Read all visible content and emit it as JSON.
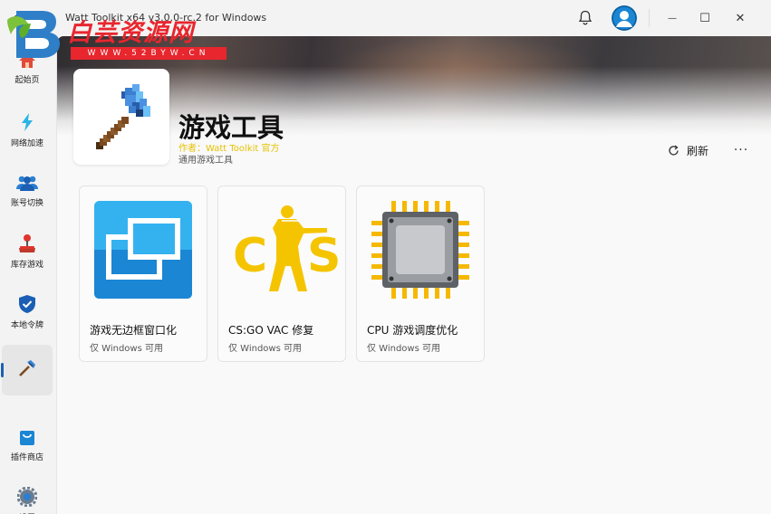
{
  "window": {
    "app_title": "Watt Toolkit x64 v3.0.0-rc.2 for Windows",
    "back_glyph": "←",
    "minimize_glyph": "—",
    "maximize_glyph": "☐",
    "close_glyph": "✕"
  },
  "watermark": {
    "brand_text": "白芸资源网",
    "url_text": "WWW.52BYW.CN",
    "color": "#e8262e"
  },
  "sidebar": {
    "items": [
      {
        "label": "起始页",
        "icon": "home-icon"
      },
      {
        "label": "网络加速",
        "icon": "lightning-icon"
      },
      {
        "label": "账号切换",
        "icon": "users-icon"
      },
      {
        "label": "库存游戏",
        "icon": "joystick-icon"
      },
      {
        "label": "本地令牌",
        "icon": "shield-icon"
      },
      {
        "label": "",
        "icon": "axe-icon",
        "active": true
      },
      {
        "label": "插件商店",
        "icon": "shopping-bag-icon"
      },
      {
        "label": "设置",
        "icon": "gear-icon"
      }
    ]
  },
  "plugin": {
    "title": "游戏工具",
    "author": "作者：Watt Toolkit 官方",
    "description": "通用游戏工具",
    "refresh_label": "刷新",
    "more_glyph": "···"
  },
  "cards": [
    {
      "name": "游戏无边框窗口化",
      "subtitle": "仅 Windows 可用",
      "icon": "borderless-window-icon"
    },
    {
      "name": "CS:GO VAC 修复",
      "subtitle": "仅 Windows 可用",
      "icon": "csgo-icon"
    },
    {
      "name": "CPU 游戏调度优化",
      "subtitle": "仅 Windows 可用",
      "icon": "cpu-icon"
    }
  ],
  "colors": {
    "accent": "#1a5fb4",
    "author_yellow": "#e6c200",
    "card_blue": "#1a86d4",
    "csgo_yellow": "#f5c400"
  }
}
